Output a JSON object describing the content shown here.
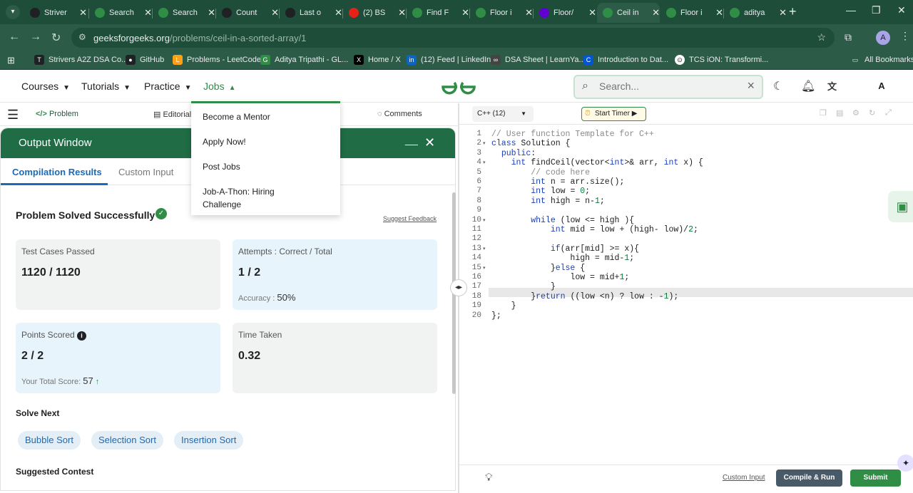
{
  "browser": {
    "tabs": [
      {
        "title": "Striver",
        "favicon": "tuf-icon",
        "color": "#202124"
      },
      {
        "title": "Search",
        "favicon": "gfg-icon",
        "color": "#2f8d46"
      },
      {
        "title": "Search",
        "favicon": "gfg-icon",
        "color": "#2f8d46"
      },
      {
        "title": "Count",
        "favicon": "tuf-icon",
        "color": "#202124"
      },
      {
        "title": "Last o",
        "favicon": "tuf-icon",
        "color": "#202124"
      },
      {
        "title": "(2) BS",
        "favicon": "youtube-icon",
        "color": "#e62117"
      },
      {
        "title": "Find F",
        "favicon": "gfg-icon",
        "color": "#2f8d46"
      },
      {
        "title": "Floor i",
        "favicon": "gfg-icon",
        "color": "#2f8d46"
      },
      {
        "title": "Floor/",
        "favicon": "yahoo-icon",
        "color": "#6001d2"
      },
      {
        "title": "Ceil in",
        "favicon": "gfg-icon",
        "color": "#2f8d46"
      },
      {
        "title": "Floor i",
        "favicon": "gfg-icon",
        "color": "#2f8d46"
      },
      {
        "title": "aditya",
        "favicon": "gfg-icon",
        "color": "#2f8d46"
      }
    ],
    "url_domain": "geeksforgeeks.org",
    "url_path": "/problems/ceil-in-a-sorted-array/1",
    "profile_letter": "A",
    "bookmarks": [
      {
        "label": "Strivers A2Z DSA Co...",
        "icon": "tuf-icon"
      },
      {
        "label": "GitHub",
        "icon": "github-icon"
      },
      {
        "label": "Problems - LeetCode",
        "icon": "leetcode-icon"
      },
      {
        "label": "Aditya Tripathi - GL...",
        "icon": "gfg-icon"
      },
      {
        "label": "Home / X",
        "icon": "x-icon"
      },
      {
        "label": "(12) Feed | LinkedIn",
        "icon": "linkedin-icon"
      },
      {
        "label": "DSA Sheet | LearnYa...",
        "icon": "learnyard-icon"
      },
      {
        "label": "Introduction to Dat...",
        "icon": "coursera-icon"
      },
      {
        "label": "TCS iON: Transformi...",
        "icon": "tcs-icon"
      }
    ],
    "all_bookmarks": "All Bookmarks"
  },
  "header": {
    "nav": [
      {
        "label": "Courses"
      },
      {
        "label": "Tutorials"
      },
      {
        "label": "Practice"
      },
      {
        "label": "Jobs"
      }
    ],
    "search_placeholder": "Search...",
    "avatar": "A"
  },
  "jobs_menu": {
    "items": [
      "Become a Mentor",
      "Apply Now!",
      "Post Jobs",
      "Job-A-Thon: Hiring Challenge"
    ]
  },
  "subnav": {
    "problem": "Problem",
    "editorial": "Editorial",
    "comments": "Comments"
  },
  "output": {
    "title": "Output Window",
    "tabs": [
      "Compilation Results",
      "Custom Input"
    ],
    "status": "Problem Solved Successfully",
    "feedback": "Suggest Feedback",
    "cards": {
      "tests_label": "Test Cases Passed",
      "tests_value": "1120 / 1120",
      "attempts_label": "Attempts : Correct / Total",
      "attempts_value": "1 / 2",
      "accuracy_label": "Accuracy :",
      "accuracy_value": "50%",
      "points_label": "Points Scored",
      "points_value": "2 / 2",
      "total_label": "Your Total Score:",
      "total_value": "57",
      "time_label": "Time Taken",
      "time_value": "0.32"
    },
    "solve_next_title": "Solve Next",
    "solve_next": [
      "Bubble Sort",
      "Selection Sort",
      "Insertion Sort"
    ],
    "suggested_contest": "Suggested Contest"
  },
  "editor": {
    "language": "C++ (12)",
    "timer": "Start Timer",
    "lines": [
      "// User function Template for C++",
      "class Solution {",
      "  public:",
      "    int findCeil(vector<int>& arr, int x) {",
      "        // code here",
      "        int n = arr.size();",
      "        int low = 0;",
      "        int high = n-1;",
      "",
      "        while (low <= high ){",
      "            int mid = low + (high- low)/2;",
      "",
      "            if(arr[mid] >= x){",
      "                high = mid-1;",
      "            }else {",
      "                low = mid+1;",
      "            }",
      "        }return ((low <n) ? low : -1);",
      "    }",
      "};"
    ],
    "custom_input": "Custom Input",
    "compile": "Compile & Run",
    "submit": "Submit"
  }
}
